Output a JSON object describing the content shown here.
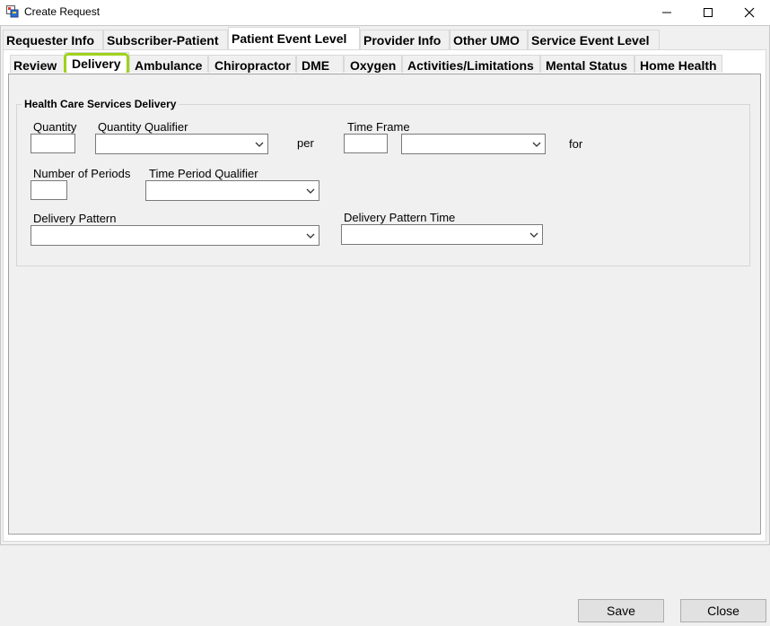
{
  "window": {
    "title": "Create Request",
    "app_icon": "form-app-icon",
    "controls": {
      "minimize": "minimize-icon",
      "maximize": "maximize-icon",
      "close": "close-icon"
    }
  },
  "main_tabs": [
    {
      "label": "Requester Info"
    },
    {
      "label": "Subscriber-Patient"
    },
    {
      "label": "Patient Event Level",
      "active": true
    },
    {
      "label": "Provider Info"
    },
    {
      "label": "Other UMO"
    },
    {
      "label": "Service Event Level"
    }
  ],
  "sub_tabs": [
    {
      "label": "Review"
    },
    {
      "label": "Delivery",
      "active": true
    },
    {
      "label": "Ambulance"
    },
    {
      "label": "Chiropractor"
    },
    {
      "label": "DME"
    },
    {
      "label": "Oxygen"
    },
    {
      "label": "Activities/Limitations"
    },
    {
      "label": "Mental Status"
    },
    {
      "label": "Home Health"
    }
  ],
  "highlight_color": "#9ed21c",
  "delivery": {
    "group_title": "Health Care Services Delivery",
    "quantity_label": "Quantity",
    "quantity_value": "",
    "quantity_qualifier_label": "Quantity Qualifier",
    "quantity_qualifier_value": "",
    "per_label": "per",
    "time_frame_label": "Time Frame",
    "time_frame_value": "",
    "time_frame_unit_value": "",
    "for_label": "for",
    "number_of_periods_label": "Number of Periods",
    "number_of_periods_value": "",
    "time_period_qualifier_label": "Time Period Qualifier",
    "time_period_qualifier_value": "",
    "delivery_pattern_label": "Delivery Pattern",
    "delivery_pattern_value": "",
    "delivery_pattern_time_label": "Delivery Pattern Time",
    "delivery_pattern_time_value": ""
  },
  "footer": {
    "save_label": "Save",
    "close_label": "Close"
  }
}
